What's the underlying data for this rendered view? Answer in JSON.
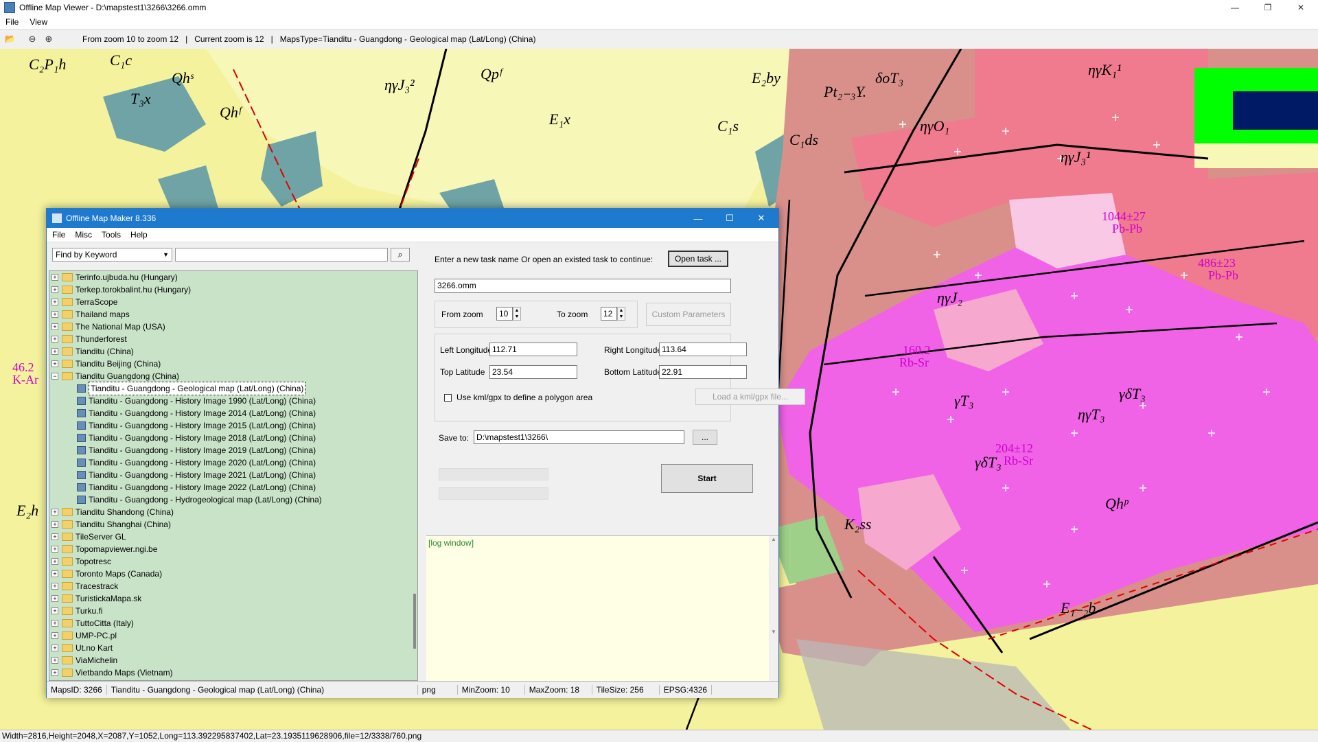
{
  "window": {
    "title": "Offline Map Viewer - D:\\mapstest1\\3266\\3266.omm",
    "menu": [
      "File",
      "View"
    ],
    "controls": {
      "minimize": "—",
      "maximize": "❐",
      "close": "✕"
    }
  },
  "toolbar": {
    "zoom_range": "From zoom 10 to zoom 12",
    "current_zoom": "Current zoom is 12",
    "maps_type": "MapsType=Tianditu - Guangdong - Geological map (Lat/Long) (China)",
    "icons": [
      "open-folder-icon",
      "zoom-out-icon",
      "zoom-in-icon"
    ]
  },
  "map": {
    "labels": [
      "C₂P₁h",
      "C₁c",
      "Qhˢ",
      "Qpᶠ",
      "T₃x",
      "Qhᶠ",
      "ηγJ₃²",
      "E₁x",
      "E₂by",
      "C₁s",
      "C₁ds",
      "Pt₂₋₃Y.",
      "δoT₃",
      "ηγK₁¹",
      "ηγO₁",
      "ηγJ₃¹",
      "ηγJ₂",
      "γT₃",
      "ηγT₃",
      "γδT₃",
      "K₂ss",
      "E₁₋₂b",
      "Qhᵖ",
      "E₂h",
      "γδT₃"
    ],
    "magenta_labels": [
      "1044±27",
      "Pb-Pb",
      "486±23",
      "Pb-Pb",
      "160.2",
      "Rb-Sr",
      "204±12",
      "Rb-Sr",
      "46.2",
      "K-Ar"
    ],
    "colors": {
      "yellow": "#f4f29c",
      "light_yellow": "#f7f7b8",
      "teal": "#6fa3a5",
      "salmon": "#d9908a",
      "rose": "#f07a8e",
      "magenta": "#f062e6",
      "pink": "#f7a8cf",
      "light_pink": "#f9c8e4",
      "gray": "#b8b8b8",
      "green_marker": "#00ff00",
      "navy_marker": "#001a66"
    }
  },
  "status": {
    "text": "Width=2816,Height=2048,X=2087,Y=1052,Long=113.392295837402,Lat=23.1935119628906,file=12/3338/760.png"
  },
  "dialog": {
    "title": "Offline Map Maker 8.336",
    "menu": [
      "File",
      "Misc",
      "Tools",
      "Help"
    ],
    "find": {
      "select_value": "Find by Keyword",
      "input_value": ""
    },
    "tree": [
      {
        "label": "Terinfo.ujbuda.hu (Hungary)",
        "expanded": false
      },
      {
        "label": "Terkep.torokbalint.hu (Hungary)",
        "expanded": false
      },
      {
        "label": "TerraScope",
        "expanded": false
      },
      {
        "label": "Thailand maps",
        "expanded": false
      },
      {
        "label": "The National Map (USA)",
        "expanded": false
      },
      {
        "label": "Thunderforest",
        "expanded": false
      },
      {
        "label": "Tianditu (China)",
        "expanded": false
      },
      {
        "label": "Tianditu Beijing (China)",
        "expanded": false
      },
      {
        "label": "Tianditu Guangdong (China)",
        "expanded": true
      }
    ],
    "tree_children": [
      "Tianditu - Guangdong - Geological map (Lat/Long) (China)",
      "Tianditu - Guangdong - History Image 1990 (Lat/Long) (China)",
      "Tianditu - Guangdong - History Image 2014 (Lat/Long) (China)",
      "Tianditu - Guangdong - History Image 2015 (Lat/Long) (China)",
      "Tianditu - Guangdong - History Image 2018 (Lat/Long) (China)",
      "Tianditu - Guangdong - History Image 2019 (Lat/Long) (China)",
      "Tianditu - Guangdong - History Image 2020 (Lat/Long) (China)",
      "Tianditu - Guangdong - History Image 2021 (Lat/Long) (China)",
      "Tianditu - Guangdong - History Image 2022 (Lat/Long) (China)",
      "Tianditu - Guangdong - Hydrogeological map (Lat/Long) (China)"
    ],
    "tree_after": [
      "Tianditu Shandong (China)",
      "Tianditu Shanghai (China)",
      "TileServer GL",
      "Topomapviewer.ngi.be",
      "Topotresc",
      "Toronto Maps (Canada)",
      "Tracestrack",
      "TuristickaMapa.sk",
      "Turku.fi",
      "TuttoCitta (Italy)",
      "UMP-PC.pl",
      "Ut.no Kart",
      "ViaMichelin",
      "Vietbando Maps (Vietnam)"
    ],
    "task_prompt": "Enter a new task name Or open an existed task to continue:",
    "open_task": "Open task ...",
    "task_name": "3266.omm",
    "from_zoom_label": "From zoom",
    "from_zoom": "10",
    "to_zoom_label": "To zoom",
    "to_zoom": "12",
    "custom_params": "Custom Parameters",
    "left_lon_label": "Left Longitude",
    "left_lon": "112.71",
    "right_lon_label": "Right Longitude",
    "right_lon": "113.64",
    "top_lat_label": "Top Latitude",
    "top_lat": "23.54",
    "bottom_lat_label": "Bottom Latitude",
    "bottom_lat": "22.91",
    "kml_label": "Use kml/gpx to define a polygon area",
    "kml_button": "Load a kml/gpx file...",
    "save_to_label": "Save to:",
    "save_to": "D:\\mapstest1\\3266\\",
    "browse": "...",
    "start": "Start",
    "log_label": "[log window]",
    "status": {
      "maps_id": "MapsID: 3266",
      "maps_name": "Tianditu - Guangdong - Geological map (Lat/Long) (China)",
      "format": "png",
      "min_zoom": "MinZoom: 10",
      "max_zoom": "MaxZoom: 18",
      "tile_size": "TileSize: 256",
      "epsg": "EPSG:4326"
    }
  }
}
